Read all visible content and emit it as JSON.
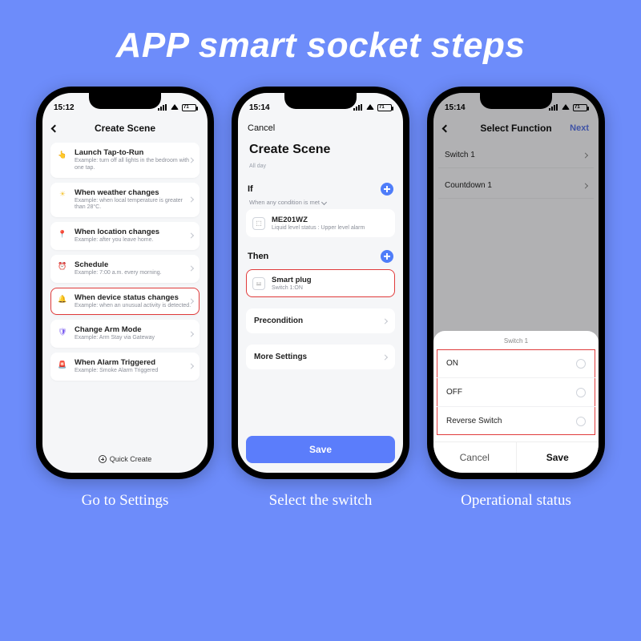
{
  "title": "APP smart socket steps",
  "captions": [
    "Go to Settings",
    "Select the switch",
    "Operational status"
  ],
  "phone1": {
    "time": "15:12",
    "battery": "71",
    "nav_title": "Create Scene",
    "cards": [
      {
        "title": "Launch Tap-to-Run",
        "sub": "Example: turn off all lights in the bedroom with one tap.",
        "icon": "👆",
        "cls": "ic-tap"
      },
      {
        "title": "When weather changes",
        "sub": "Example: when local temperature is greater than 28°C.",
        "icon": "☀",
        "cls": "ic-sun"
      },
      {
        "title": "When location changes",
        "sub": "Example: after you leave home.",
        "icon": "📍",
        "cls": "ic-pin"
      },
      {
        "title": "Schedule",
        "sub": "Example: 7:00 a.m. every morning.",
        "icon": "⏰",
        "cls": "ic-clock"
      },
      {
        "title": "When device status changes",
        "sub": "Example: when an unusual activity is detected.",
        "icon": "🔔",
        "cls": "ic-bell",
        "hl": true
      },
      {
        "title": "Change Arm Mode",
        "sub": "Example: Arm Stay via Gateway",
        "icon": "🛡",
        "cls": "ic-shield"
      },
      {
        "title": "When Alarm Triggered",
        "sub": "Example: Smoke Alarm Triggered",
        "icon": "🚨",
        "cls": "ic-alarm"
      }
    ],
    "quick": "Quick Create"
  },
  "phone2": {
    "time": "15:14",
    "battery": "71",
    "cancel": "Cancel",
    "title": "Create Scene",
    "subtitle": "All day",
    "if_label": "If",
    "if_sub": "When any condition is met",
    "if_device_title": "ME201WZ",
    "if_device_sub": "Liquid level status : Upper level alarm",
    "then_label": "Then",
    "then_device_title": "Smart plug",
    "then_device_sub": "Switch 1:ON",
    "precondition": "Precondition",
    "more": "More Settings",
    "save": "Save"
  },
  "phone3": {
    "time": "15:14",
    "battery": "71",
    "nav_title": "Select Function",
    "next": "Next",
    "rows": [
      "Switch 1",
      "Countdown 1"
    ],
    "sheet_title": "Switch 1",
    "opts": [
      "ON",
      "OFF",
      "Reverse Switch"
    ],
    "cancel": "Cancel",
    "save": "Save"
  }
}
